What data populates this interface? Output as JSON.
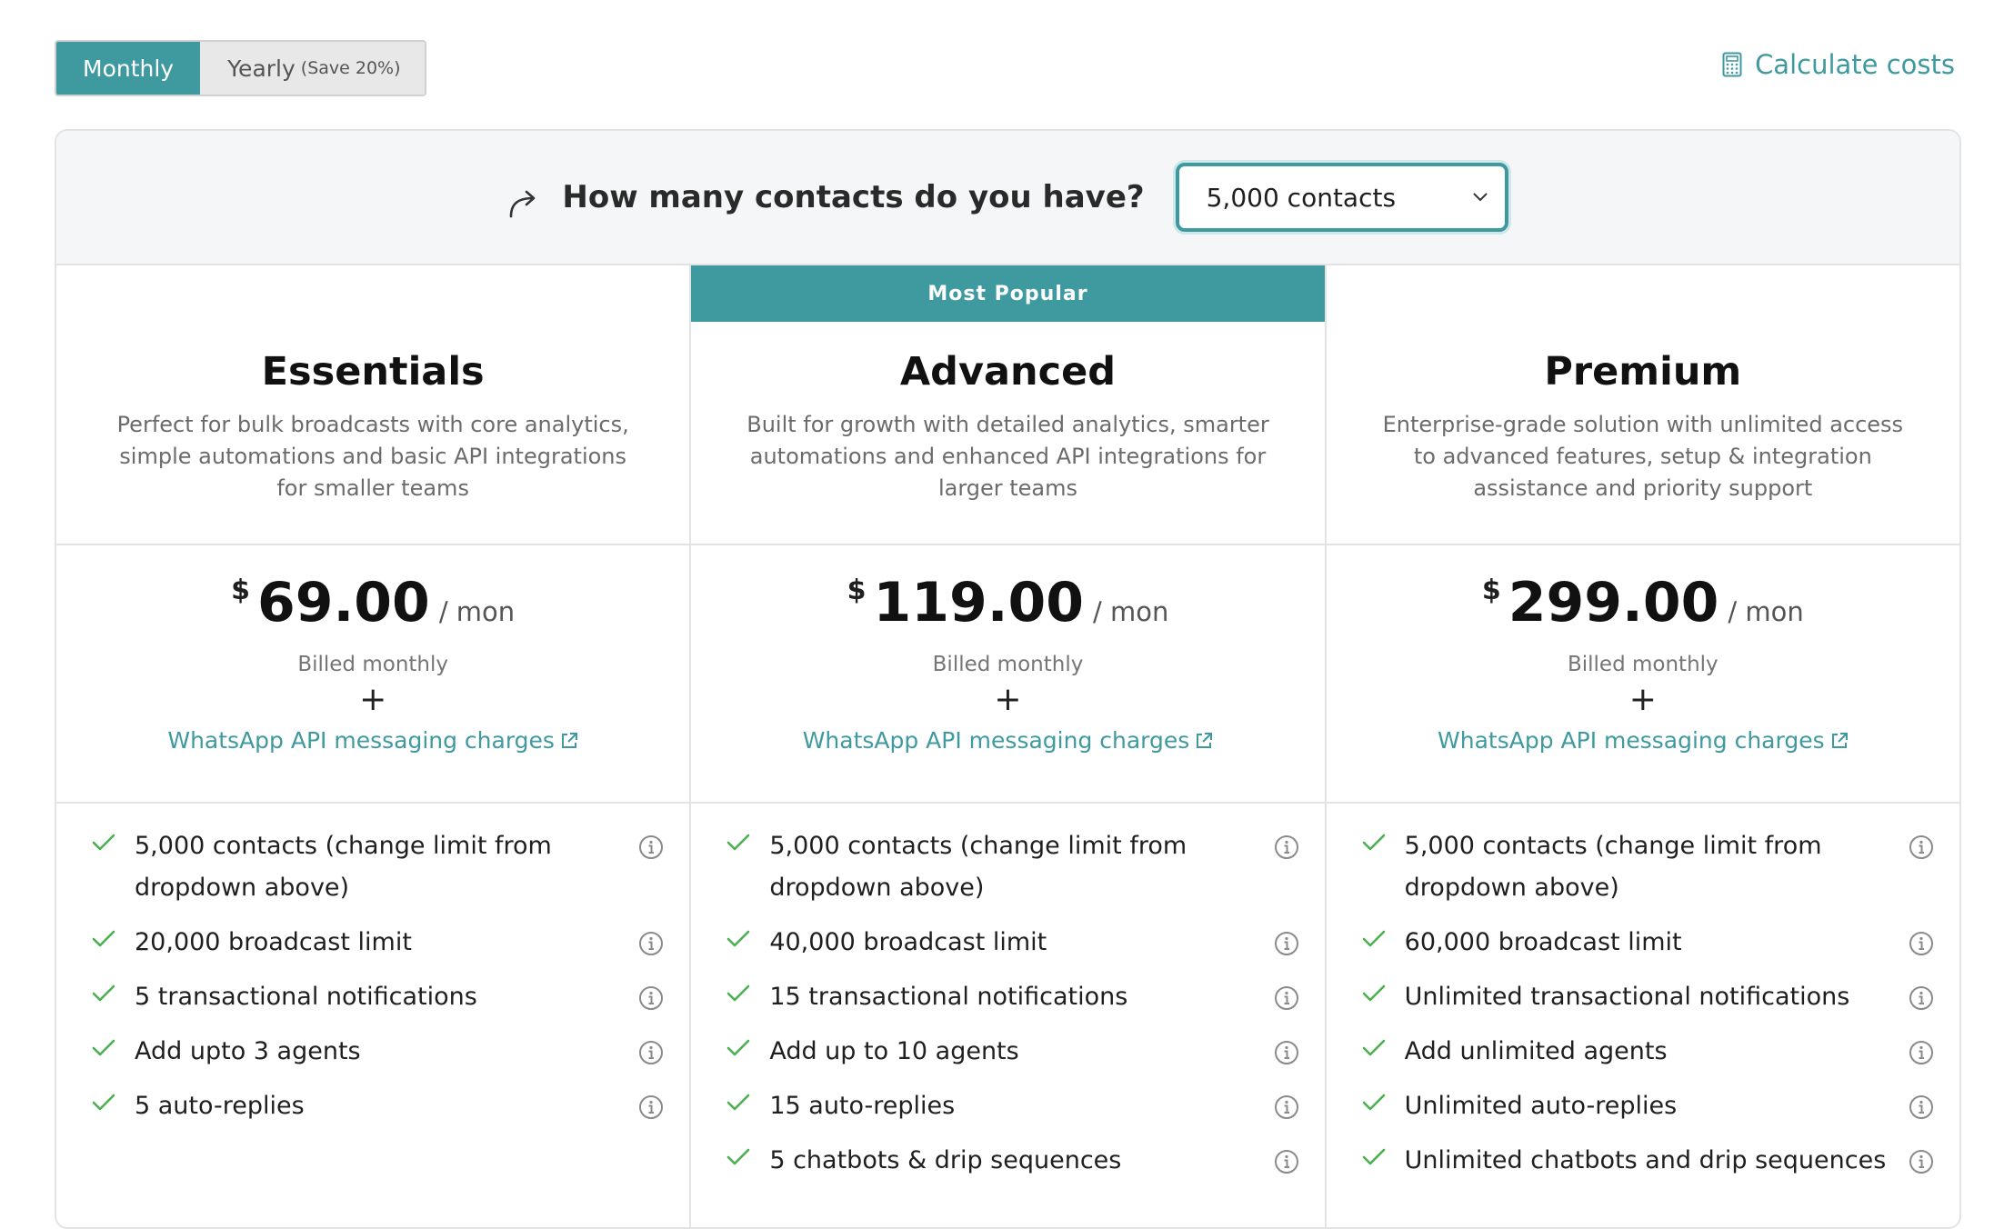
{
  "billing_toggle": {
    "monthly_label": "Monthly",
    "yearly_label": "Yearly",
    "yearly_save": "(Save 20%)",
    "selected": "Monthly"
  },
  "calculate_label": "Calculate costs",
  "question": {
    "text": "How many contacts do you have?",
    "selected_value": "5,000 contacts"
  },
  "popular_badge": "Most Popular",
  "plans": [
    {
      "name": "Essentials",
      "description": "Perfect for bulk broadcasts with core analytics, simple automations and basic API integrations for smaller teams",
      "currency": "$",
      "price": "69.00",
      "period": "/ mon",
      "billed": "Billed monthly",
      "plus": "+",
      "charges_label": "WhatsApp API messaging charges",
      "features": [
        "5,000 contacts (change limit from dropdown above)",
        "20,000 broadcast limit",
        "5 transactional notifications",
        "Add upto 3 agents",
        "5 auto-replies"
      ]
    },
    {
      "name": "Advanced",
      "description": "Built for growth with detailed analytics, smarter automations and enhanced API integrations for larger teams",
      "currency": "$",
      "price": "119.00",
      "period": "/ mon",
      "billed": "Billed monthly",
      "plus": "+",
      "charges_label": "WhatsApp API messaging charges",
      "features": [
        "5,000 contacts (change limit from dropdown above)",
        "40,000 broadcast limit",
        "15 transactional notifications",
        "Add up to 10 agents",
        "15 auto-replies",
        "5 chatbots & drip sequences"
      ]
    },
    {
      "name": "Premium",
      "description": "Enterprise-grade solution with unlimited access to advanced features, setup & integration assistance and priority support",
      "currency": "$",
      "price": "299.00",
      "period": "/ mon",
      "billed": "Billed monthly",
      "plus": "+",
      "charges_label": "WhatsApp API messaging charges",
      "features": [
        "5,000 contacts (change limit from dropdown above)",
        "60,000 broadcast limit",
        "Unlimited transactional notifications",
        "Add unlimited agents",
        "Unlimited auto-replies",
        "Unlimited chatbots and drip sequences"
      ]
    }
  ],
  "colors": {
    "accent": "#3f9aa0",
    "check": "#4caf50"
  }
}
